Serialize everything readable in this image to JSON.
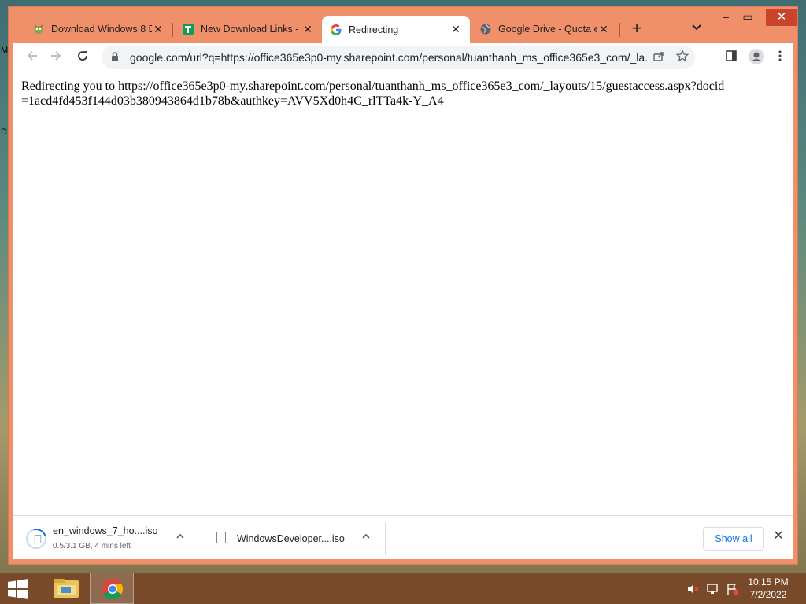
{
  "desktop": {
    "letters": [
      "M",
      "D"
    ]
  },
  "browser": {
    "tabs": [
      {
        "title": "Download Windows 8 D",
        "icon": "bug-icon"
      },
      {
        "title": "New Download Links - ",
        "icon": "sheets-icon"
      },
      {
        "title": "Redirecting",
        "icon": "google-icon",
        "active": true
      },
      {
        "title": "Google Drive - Quota e",
        "icon": "globe-icon"
      }
    ],
    "new_tab": "+",
    "window_controls": {
      "minimize": "–",
      "maximize": "▭",
      "close": "✕"
    },
    "address_bar": {
      "url": "google.com/url?q=https://office365e3p0-my.sharepoint.com/personal/tuanthanh_ms_office365e3_com/_la..."
    },
    "page_text": "Redirecting you to https://office365e3p0-my.sharepoint.com/personal/tuanthanh_ms_office365e3_com/_layouts/15/guestaccess.aspx?docid=1acd4fd453f144d03b380943864d1b78b&authkey=AVV5Xd0h4C_rlTTa4k-Y_A4",
    "downloads": [
      {
        "name": "en_windows_7_ho....iso",
        "status": "0.5/3.1 GB, 4 mins left",
        "in_progress": true
      },
      {
        "name": "WindowsDeveloper....iso",
        "status": "",
        "in_progress": false
      }
    ],
    "show_all_label": "Show all"
  },
  "taskbar": {
    "time": "10:15 PM",
    "date": "7/2/2022"
  },
  "colors": {
    "frame": "#f0906a",
    "accent": "#1a73e8",
    "taskbar": "#784828"
  }
}
